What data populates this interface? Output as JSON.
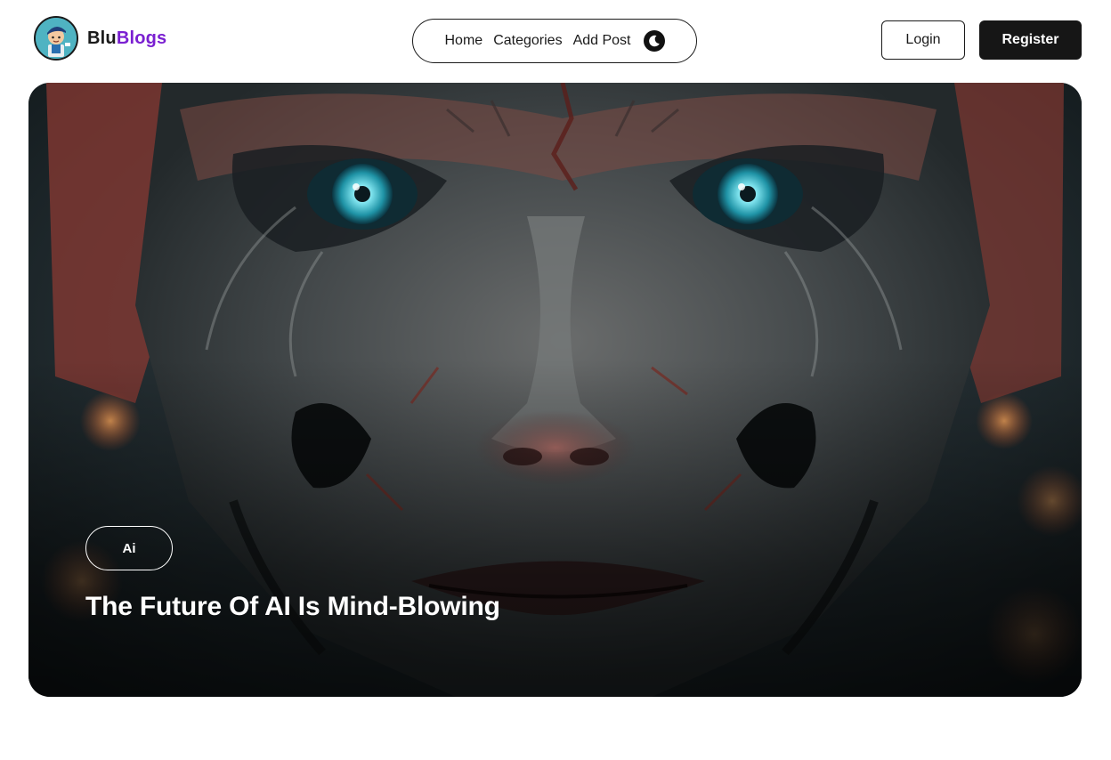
{
  "brand": {
    "name_part1": "Blu",
    "name_part2": "Blogs",
    "accent_color": "#7a1fd1",
    "logo_icon": "cartoon-boy-avatar"
  },
  "nav": {
    "items": [
      {
        "label": "Home"
      },
      {
        "label": "Categories"
      },
      {
        "label": "Add Post"
      }
    ],
    "theme_toggle_icon": "moon-icon"
  },
  "auth": {
    "login_label": "Login",
    "register_label": "Register"
  },
  "hero": {
    "image_icon": "ai-generated-face-illustration",
    "tag": "Ai",
    "title": "The Future Of AI Is Mind-Blowing"
  },
  "colors": {
    "text": "#161616",
    "register_bg": "#161616",
    "background": "#ffffff"
  }
}
